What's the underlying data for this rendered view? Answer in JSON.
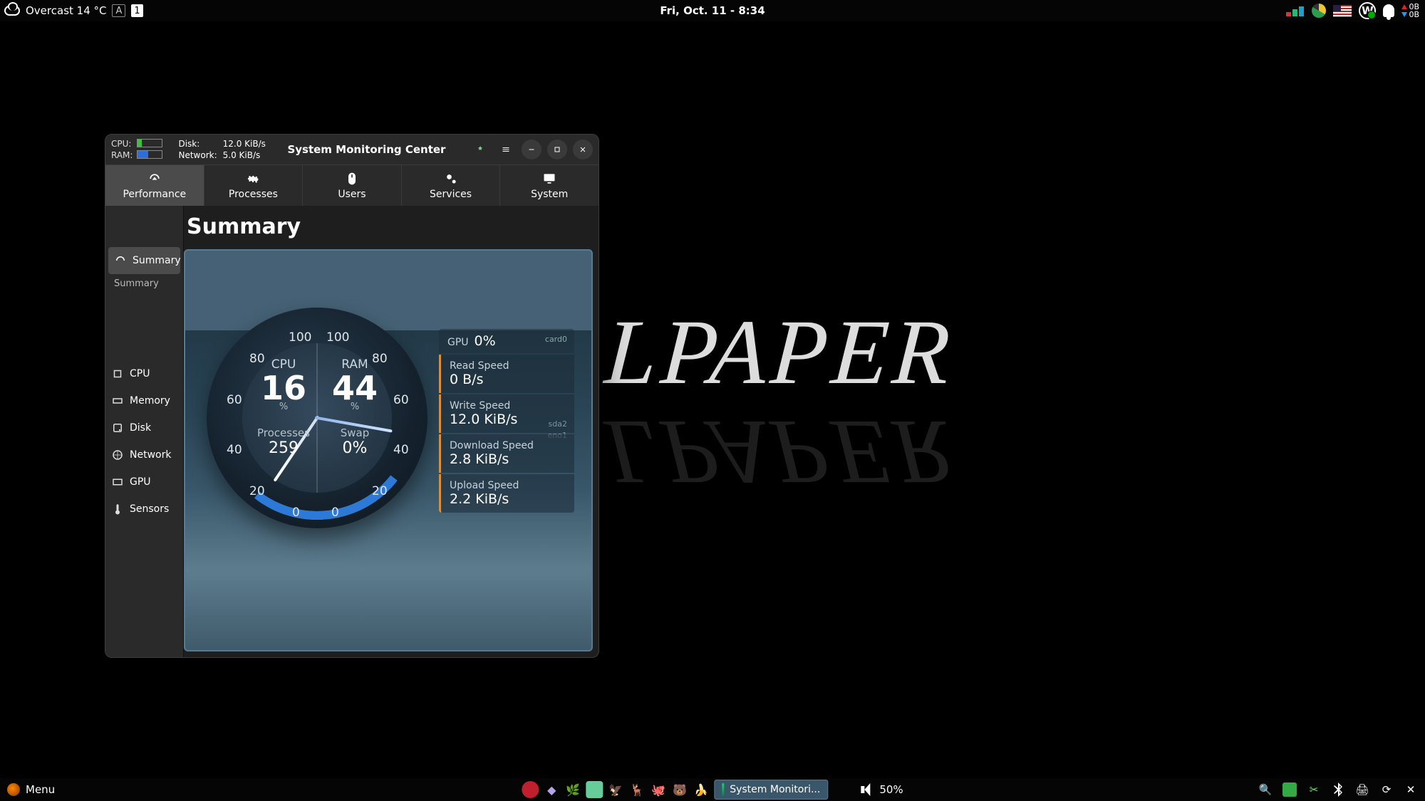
{
  "top_panel": {
    "weather": "Overcast 14 °C",
    "workspace_letter": "A",
    "workspace_number": "1",
    "datetime": "Fri, Oct. 11 - 8:34",
    "net_up": "0B",
    "net_down": "0B"
  },
  "bottom_panel": {
    "menu_label": "Menu",
    "active_task": "System Monitori...",
    "volume": "50%"
  },
  "wallpaper": {
    "text": "LPAPER"
  },
  "app": {
    "titlebar": {
      "cpu_label": "CPU:",
      "ram_label": "RAM:",
      "disk_label": "Disk:",
      "disk_value": "12.0 KiB/s",
      "net_label": "Network:",
      "net_value": "5.0 KiB/s",
      "title": "System Monitoring Center",
      "cpu_meter_pct": 16,
      "ram_meter_pct": 44
    },
    "tabs": {
      "performance": "Performance",
      "processes": "Processes",
      "users": "Users",
      "services": "Services",
      "system": "System"
    },
    "sidebar": {
      "summary": "Summary",
      "summary_sub": "Summary",
      "cpu": "CPU",
      "memory": "Memory",
      "disk": "Disk",
      "network": "Network",
      "gpu": "GPU",
      "sensors": "Sensors"
    },
    "heading": "Summary",
    "gauge": {
      "cpu_label": "CPU",
      "cpu_value": "16",
      "cpu_unit": "%",
      "ram_label": "RAM",
      "ram_value": "44",
      "ram_unit": "%",
      "processes_label": "Processes",
      "processes_value": "259",
      "swap_label": "Swap",
      "swap_value": "0%",
      "ticks_left": {
        "t0": "0",
        "t20": "20",
        "t40": "40",
        "t60": "60",
        "t80": "80",
        "t100": "100"
      },
      "ticks_right": {
        "t0": "0",
        "t20": "20",
        "t40": "40",
        "t60": "60",
        "t80": "80",
        "t100": "100"
      }
    },
    "info": {
      "gpu_label": "GPU",
      "gpu_value": "0%",
      "gpu_dev": "card0",
      "read_label": "Read Speed",
      "read_value": "0 B/s",
      "write_label": "Write Speed",
      "write_value": "12.0 KiB/s",
      "disk_dev": "sda2",
      "net_dev": "eno1",
      "down_label": "Download Speed",
      "down_value": "2.8 KiB/s",
      "up_label": "Upload Speed",
      "up_value": "2.2 KiB/s"
    }
  }
}
